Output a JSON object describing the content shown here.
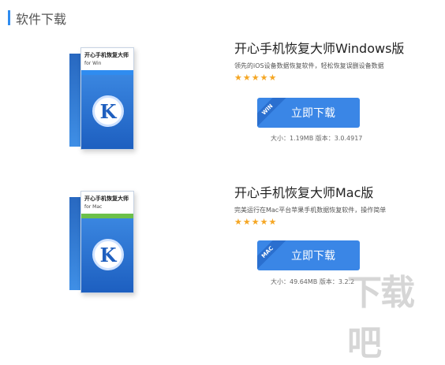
{
  "section": {
    "title": "软件下载"
  },
  "products": [
    {
      "box_name": "开心手机恢复大师",
      "box_platform": "for Win",
      "box_badge": "K",
      "accent_color": "#2f8cf0",
      "title": "开心手机恢复大师Windows版",
      "desc": "领先的iOS设备数据恢复软件，轻松恢复误删设备数据",
      "stars": "★★★★★",
      "ribbon": "WIN",
      "button_label": "立即下载",
      "meta": "大小：1.19MB 版本：3.0.4917"
    },
    {
      "box_name": "开心手机恢复大师",
      "box_platform": "for Mac",
      "box_badge": "K",
      "accent_color": "#6cc04a",
      "title": "开心手机恢复大师Mac版",
      "desc": "完美运行在Mac平台苹果手机数据恢复软件，操作简单",
      "stars": "★★★★★",
      "ribbon": "MAC",
      "button_label": "立即下载",
      "meta": "大小：49.64MB 版本：3.2.2"
    }
  ],
  "watermark": "下载吧"
}
